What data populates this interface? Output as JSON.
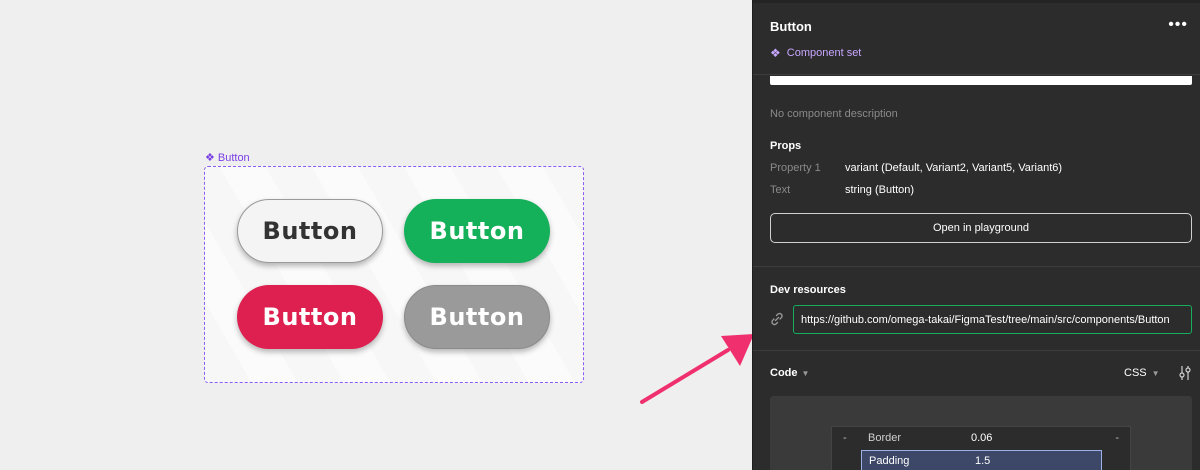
{
  "canvas": {
    "component_set_label": "Button",
    "variants": [
      {
        "label": "Button",
        "style": "default"
      },
      {
        "label": "Button",
        "style": "green"
      },
      {
        "label": "Button",
        "style": "red"
      },
      {
        "label": "Button",
        "style": "gray"
      }
    ]
  },
  "panel": {
    "title": "Button",
    "more_icon": "more-horizontal-icon",
    "type_label": "Component set",
    "description": "No component description",
    "props_heading": "Props",
    "props": [
      {
        "key": "Property 1",
        "value": "variant (Default, Variant2, Variant5, Variant6)"
      },
      {
        "key": "Text",
        "value": "string (Button)"
      }
    ],
    "playground_button": "Open in playground",
    "dev_resources_heading": "Dev resources",
    "dev_resource_url": "https://github.com/omega-takai/FigmaTest/tree/main/src/components/Button",
    "code_heading": "Code",
    "code_language": "CSS",
    "box_model": {
      "border_label": "Border",
      "border_value": "0.06",
      "padding_label": "Padding",
      "padding_value": "1.5"
    }
  },
  "colors": {
    "accent_purple": "#8b5cf6",
    "green": "#14b05a",
    "red": "#dd2050",
    "gray": "#9a9a9a",
    "arrow_pink": "#f0306e",
    "panel_bg": "#2c2c2c"
  }
}
